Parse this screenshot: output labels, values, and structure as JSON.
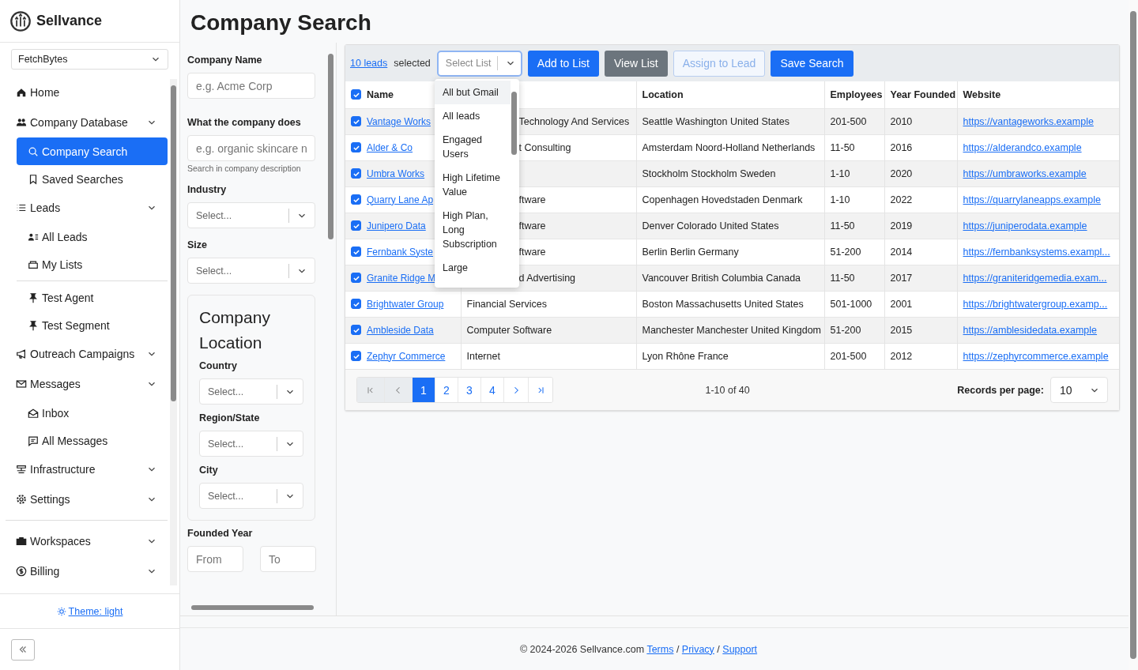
{
  "brand": {
    "name": "Sellvance"
  },
  "workspace_select": {
    "value": "FetchBytes"
  },
  "nav": [
    {
      "label": "Home",
      "kind": "link"
    },
    {
      "label": "Company Database",
      "kind": "group",
      "children": [
        {
          "label": "Company Search",
          "selected": true
        },
        {
          "label": "Saved Searches",
          "selected": false
        }
      ]
    },
    {
      "label": "Leads",
      "kind": "group",
      "children": [
        {
          "label": "All Leads",
          "selected": false
        },
        {
          "label": "My Lists",
          "selected": false
        },
        {
          "kind": "divider"
        },
        {
          "label": "Test Agent",
          "selected": false
        },
        {
          "label": "Test Segment",
          "selected": false
        }
      ]
    },
    {
      "label": "Outreach Campaigns",
      "kind": "group"
    },
    {
      "label": "Messages",
      "kind": "group",
      "children": [
        {
          "label": "Inbox",
          "selected": false
        },
        {
          "label": "All Messages",
          "selected": false
        }
      ]
    },
    {
      "label": "Infrastructure",
      "kind": "group"
    },
    {
      "label": "Settings",
      "kind": "group"
    },
    {
      "kind": "divider"
    },
    {
      "label": "Workspaces",
      "kind": "group"
    },
    {
      "label": "Billing",
      "kind": "group"
    }
  ],
  "theme_link": "Theme: light",
  "page_title": "Company Search",
  "filters": {
    "company_name": {
      "label": "Company Name",
      "placeholder": "e.g. Acme Corp"
    },
    "description": {
      "label": "What the company does",
      "placeholder": "e.g. organic skincare n",
      "hint": "Search in company description"
    },
    "industry": {
      "label": "Industry",
      "placeholder": "Select..."
    },
    "size": {
      "label": "Size",
      "placeholder": "Select..."
    },
    "location": {
      "title": "Company Location",
      "fields": [
        {
          "label": "Country",
          "placeholder": "Select..."
        },
        {
          "label": "Region/State",
          "placeholder": "Select..."
        },
        {
          "label": "City",
          "placeholder": "Select..."
        }
      ]
    },
    "founded_year": {
      "label": "Founded Year",
      "from_placeholder": "From",
      "to_placeholder": "To"
    }
  },
  "toolbar": {
    "leads_link": "10 leads",
    "selected_text": "selected",
    "list_select": {
      "placeholder": "Select List"
    },
    "buttons": [
      {
        "label": "Add to List",
        "kind": "primary"
      },
      {
        "label": "View List",
        "kind": "secondary"
      },
      {
        "label": "Assign to Lead",
        "kind": "outline"
      },
      {
        "label": "Save Search",
        "kind": "primary"
      }
    ]
  },
  "list_menu": {
    "options": [
      {
        "label": "All but Gmail",
        "selected": true
      },
      {
        "label": "All leads",
        "selected": false
      },
      {
        "label": "Engaged Users",
        "selected": false
      },
      {
        "label": "High Lifetime Value",
        "selected": false
      },
      {
        "label": "High Plan, Long Subscription",
        "selected": false
      },
      {
        "label": "Large",
        "selected": false
      }
    ]
  },
  "table": {
    "all_checked": true,
    "columns": [
      {
        "label": "Name"
      },
      {},
      {
        "label": "Location"
      },
      {
        "label": "Employees"
      },
      {
        "label": "Year Founded"
      },
      {
        "label": "Website"
      }
    ],
    "rows": [
      {
        "checked": true,
        "cells": [
          "Vantage Works",
          "Technology And Services",
          "Seattle Washington United States",
          "201-500",
          "2010",
          "https://vantageworks.example"
        ]
      },
      {
        "checked": true,
        "cells": [
          "Alder & Co",
          "t Consulting",
          "Amsterdam Noord-Holland Netherlands",
          "11-50",
          "2016",
          "https://alderandco.example"
        ]
      },
      {
        "checked": true,
        "cells": [
          "Umbra Works",
          null,
          "Stockholm Stockholm Sweden",
          "1-10",
          "2020",
          "https://umbraworks.example"
        ]
      },
      {
        "checked": true,
        "cells": [
          "Quarry Lane Ap",
          "ftware",
          "Copenhagen Hovedstaden Denmark",
          "1-10",
          "2022",
          "https://quarrylaneapps.example"
        ]
      },
      {
        "checked": true,
        "cells": [
          "Junipero Data",
          "ftware",
          "Denver Colorado United States",
          "11-50",
          "2019",
          "https://juniperodata.example"
        ]
      },
      {
        "checked": true,
        "cells": [
          "Fernbank Syste",
          "ftware",
          "Berlin Berlin Germany",
          "51-200",
          "2014",
          "https://fernbanksystems.exampl..."
        ]
      },
      {
        "checked": true,
        "cells": [
          "Granite Ridge M",
          "d Advertising",
          "Vancouver British Columbia Canada",
          "11-50",
          "2017",
          "https://graniteridgemedia.exam..."
        ]
      },
      {
        "checked": true,
        "cells": [
          "Brightwater Group",
          "Financial Services",
          "Boston Massachusetts United States",
          "501-1000",
          "2001",
          "https://brightwatergroup.examp..."
        ]
      },
      {
        "checked": true,
        "cells": [
          "Ambleside Data",
          "Computer Software",
          "Manchester Manchester United Kingdom",
          "51-200",
          "2015",
          "https://amblesidedata.example"
        ]
      },
      {
        "checked": true,
        "cells": [
          "Zephyr Commerce",
          "Internet",
          "Lyon Rhône France",
          "201-500",
          "2012",
          "https://zephyrcommerce.example"
        ]
      }
    ]
  },
  "pagination": {
    "pages": [
      {
        "label": "1",
        "selected": true
      },
      {
        "label": "2",
        "selected": false
      },
      {
        "label": "3",
        "selected": false
      },
      {
        "label": "4",
        "selected": false
      }
    ],
    "range": "1-10 of 40",
    "per_page_label": "Records per page:",
    "per_page_value": "10"
  },
  "footer": {
    "copyright": "© 2024-2026 Sellvance.com",
    "links": [
      "Terms",
      "Privacy",
      "Support"
    ],
    "separator": "/"
  }
}
